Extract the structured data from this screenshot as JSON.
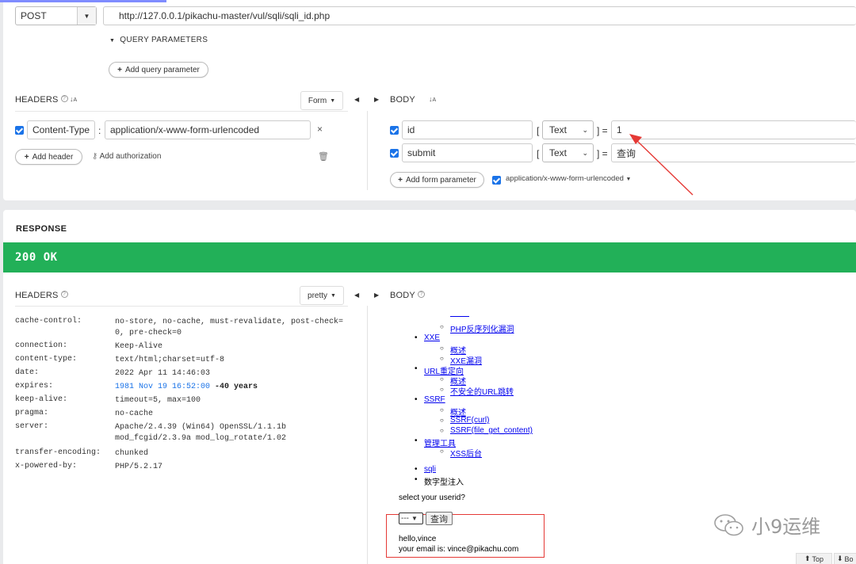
{
  "request": {
    "method": "POST",
    "url": "http://127.0.0.1/pikachu-master/vul/sqli/sqli_id.php",
    "query_params_label": "QUERY PARAMETERS",
    "add_query_param": "Add query parameter",
    "headers_label": "HEADERS",
    "headers_mode": "Form",
    "headers": [
      {
        "name": "Content-Type",
        "value": "application/x-www-form-urlencoded"
      }
    ],
    "add_header": "Add header",
    "add_authorization": "Add authorization",
    "body_label": "BODY",
    "body_params": [
      {
        "name": "id",
        "type": "Text",
        "value": "1"
      },
      {
        "name": "submit",
        "type": "Text",
        "value": "查询"
      }
    ],
    "add_form_param": "Add form parameter",
    "content_type": "application/x-www-form-urlencoded"
  },
  "response": {
    "title": "RESPONSE",
    "status": "200 OK",
    "status_color": "#22b058",
    "headers_label": "HEADERS",
    "headers_mode": "pretty",
    "body_label": "BODY",
    "headers": [
      {
        "key": "cache-control:",
        "value": "no-store, no-cache, must-revalidate, post-check=0, pre-check=0"
      },
      {
        "key": "connection:",
        "value": "Keep-Alive"
      },
      {
        "key": "content-type:",
        "value": "text/html;charset=utf-8"
      },
      {
        "key": "date:",
        "value": "2022 Apr 11 14:46:03"
      },
      {
        "key": "expires:",
        "value": "1981 Nov 19 16:52:00",
        "extra": "-40 years"
      },
      {
        "key": "keep-alive:",
        "value": "timeout=5, max=100"
      },
      {
        "key": "pragma:",
        "value": "no-cache"
      },
      {
        "key": "server:",
        "value": "Apache/2.4.39 (Win64) OpenSSL/1.1.1b mod_fcgid/2.3.9a mod_log_rotate/1.02"
      },
      {
        "key": "transfer-encoding:",
        "value": "chunked"
      },
      {
        "key": "x-powered-by:",
        "value": "PHP/5.2.17"
      }
    ],
    "body": {
      "php_unserialize": "PHP反序列化漏洞",
      "xxe": "XXE",
      "xxe_overview": "概述",
      "xxe_vuln": "XXE漏洞",
      "url_redirect": "URL重定向",
      "url_overview": "概述",
      "url_unsafe": "不安全的URL跳转",
      "ssrf": "SSRF",
      "ssrf_overview": "概述",
      "ssrf_curl": "SSRF(curl)",
      "ssrf_fgc": "SSRF(file_get_content)",
      "admin_tools": "管理工具",
      "xss_backend": "XSS后台",
      "crumb_sqli": "sqli",
      "crumb_current": "数字型注入",
      "prompt": "select your userid?",
      "select_value": "---",
      "submit": "查询",
      "hello": "hello,vince",
      "email": "your email is: vince@pikachu.com"
    }
  },
  "watermark": "小9运维",
  "footer": {
    "top": "Top",
    "bottom": "Bo"
  },
  "colors": {
    "accent": "#1a73e8",
    "annotation": "#e53935"
  }
}
